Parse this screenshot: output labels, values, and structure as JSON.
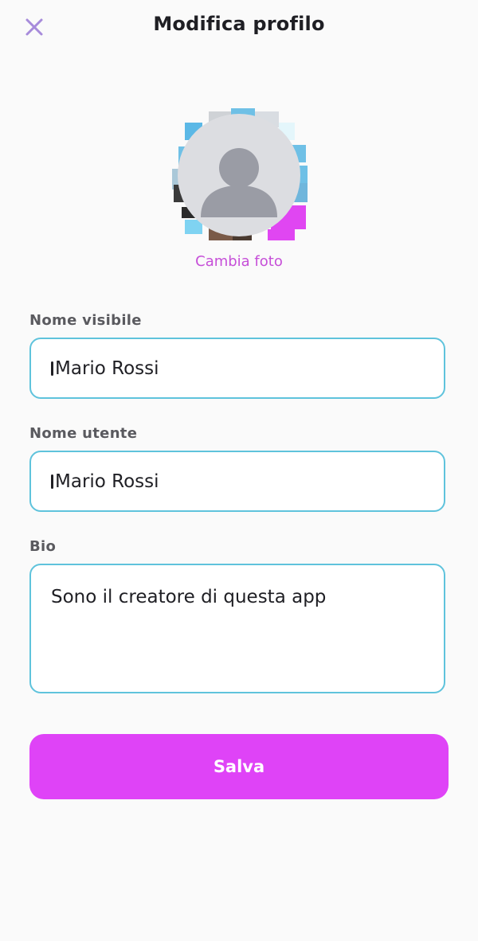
{
  "header": {
    "title": "Modifica profilo",
    "close_icon": "close-icon"
  },
  "profile_photo": {
    "avatar_icon": "user-silhouette-icon",
    "change_label": "Cambia foto"
  },
  "form": {
    "display_name": {
      "label": "Nome visibile",
      "value": "Mario Rossi"
    },
    "username": {
      "label": "Nome utente",
      "value": "Mario Rossi"
    },
    "bio": {
      "label": "Bio",
      "value": "Sono il creatore di questa app"
    }
  },
  "actions": {
    "save_label": "Salva"
  },
  "colors": {
    "accent": "#df43f7",
    "link": "#c64fd8",
    "close_icon": "#a78bdb",
    "field_border": "#5fc3dc",
    "background": "#fafafa"
  }
}
